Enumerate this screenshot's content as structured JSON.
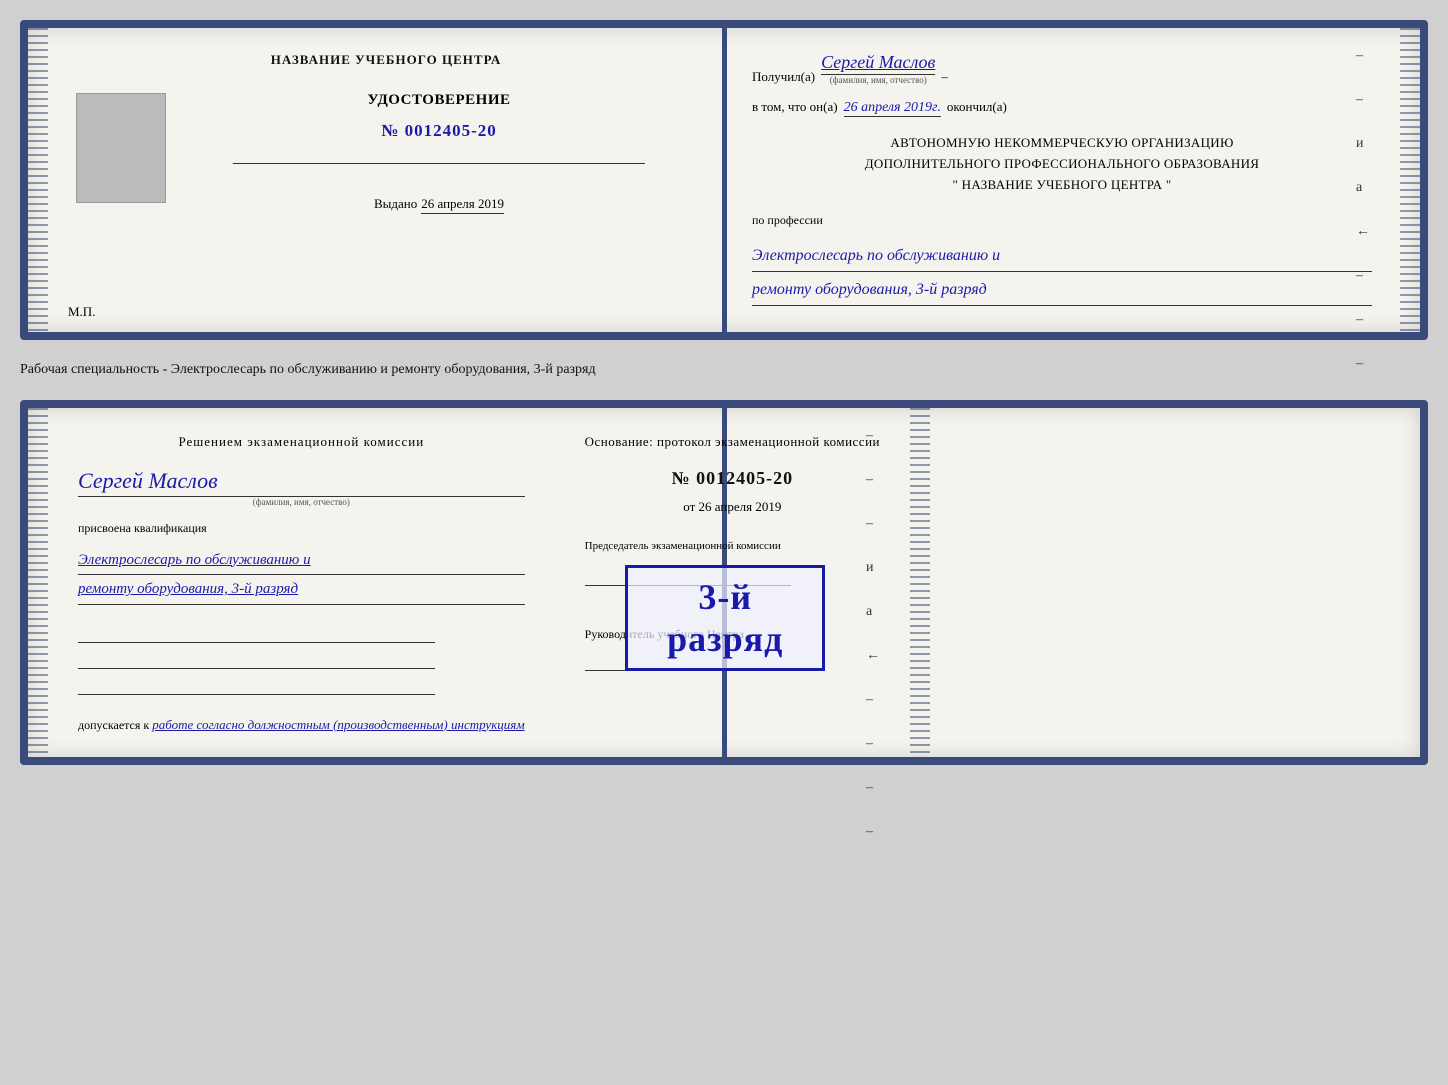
{
  "card1": {
    "left": {
      "center_title": "НАЗВАНИЕ УЧЕБНОГО ЦЕНТРА",
      "cert_label": "УДОСТОВЕРЕНИЕ",
      "cert_number": "№ 0012405-20",
      "issued_label": "Выдано",
      "issued_date": "26 апреля 2019",
      "mp_label": "М.П."
    },
    "right": {
      "received_label": "Получил(а)",
      "recipient_name": "Сергей Маслов",
      "name_subtitle": "(фамилия, имя, отчество)",
      "dash": "–",
      "in_that_label": "в том, что он(а)",
      "completion_date": "26 апреля 2019г.",
      "finished_label": "окончил(а)",
      "org_line1": "АВТОНОМНУЮ НЕКОММЕРЧЕСКУЮ ОРГАНИЗАЦИЮ",
      "org_line2": "ДОПОЛНИТЕЛЬНОГО ПРОФЕССИОНАЛЬНОГО ОБРАЗОВАНИЯ",
      "org_line3": "\"  НАЗВАНИЕ УЧЕБНОГО ЦЕНТРА  \"",
      "profession_label": "по профессии",
      "profession_line1": "Электрослесарь по обслуживанию и",
      "profession_line2": "ремонту оборудования, 3-й разряд"
    }
  },
  "between_text": "Рабочая специальность - Электрослесарь по обслуживанию и ремонту оборудования, 3-й разряд",
  "card2": {
    "left": {
      "commission_title": "Решением экзаменационной  комиссии",
      "person_name": "Сергей Маслов",
      "person_subtitle": "(фамилия, имя, отчество)",
      "qualification_label": "присвоена квалификация",
      "qualification_line1": "Электрослесарь по обслуживанию и",
      "qualification_line2": "ремонту оборудования, 3-й разряд",
      "допускается_label": "допускается к",
      "допускается_text": "работе согласно должностным (производственным) инструкциям"
    },
    "right": {
      "osnov_label": "Основание: протокол экзаменационной  комиссии",
      "protocol_number": "№  0012405-20",
      "protocol_date_prefix": "от",
      "protocol_date": "26 апреля 2019",
      "stamp_text": "3-й разряд",
      "chairman_label": "Председатель экзаменационной комиссии",
      "руководитель_label": "Руководитель учебного Центра"
    }
  }
}
